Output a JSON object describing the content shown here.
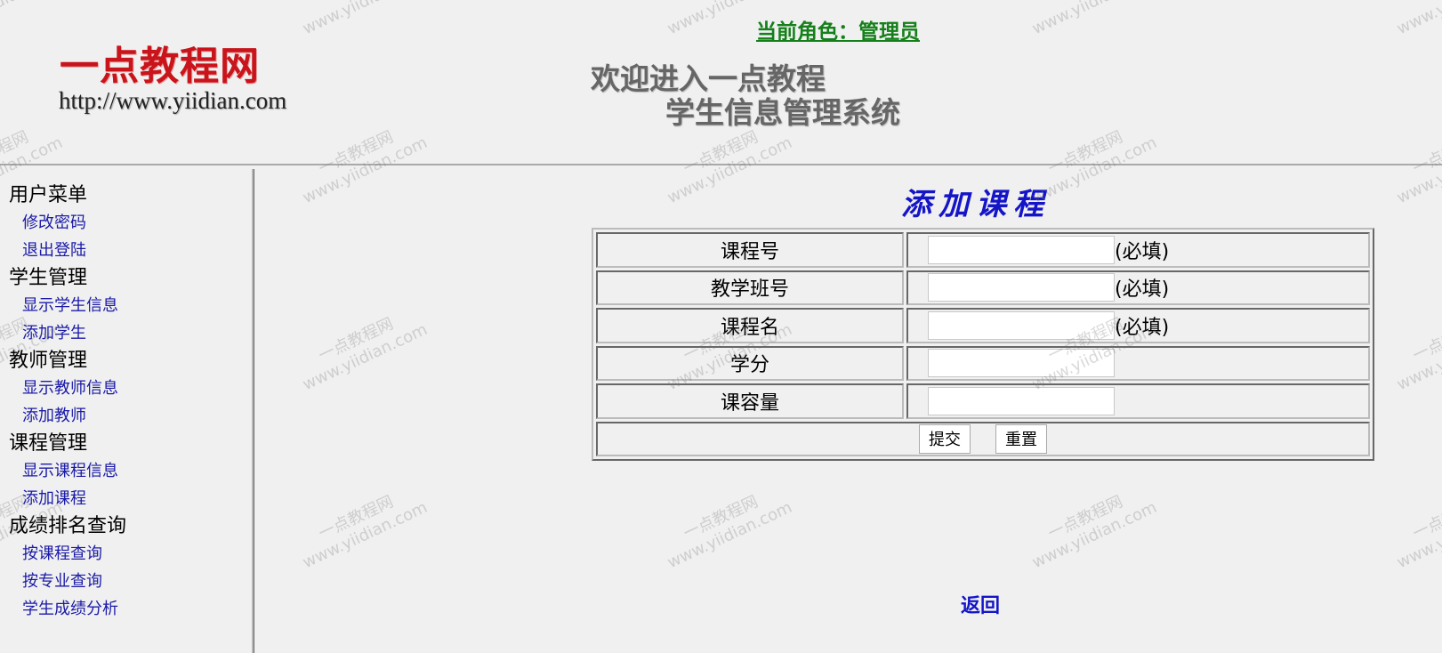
{
  "header": {
    "logo_title": "一点教程网",
    "logo_url": "http://www.yiidian.com",
    "role_text": "当前角色：管理员",
    "welcome_line1": "欢迎进入一点教程",
    "welcome_line2": "学生信息管理系统"
  },
  "sidebar": {
    "groups": [
      {
        "title": "用户菜单",
        "items": [
          "修改密码",
          "退出登陆"
        ]
      },
      {
        "title": "学生管理",
        "items": [
          "显示学生信息",
          "添加学生"
        ]
      },
      {
        "title": "教师管理",
        "items": [
          "显示教师信息",
          "添加教师"
        ]
      },
      {
        "title": "课程管理",
        "items": [
          "显示课程信息",
          "添加课程"
        ]
      },
      {
        "title": "成绩排名查询",
        "items": [
          "按课程查询",
          "按专业查询",
          "学生成绩分析"
        ]
      }
    ]
  },
  "form": {
    "title": "添加课程",
    "fields": [
      {
        "label": "课程号",
        "value": "",
        "required_note": "(必填)"
      },
      {
        "label": "教学班号",
        "value": "",
        "required_note": "(必填)"
      },
      {
        "label": "课程名",
        "value": "",
        "required_note": "(必填)"
      },
      {
        "label": "学分",
        "value": "",
        "required_note": ""
      },
      {
        "label": "课容量",
        "value": "",
        "required_note": ""
      }
    ],
    "submit_label": "提交",
    "reset_label": "重置"
  },
  "back_link": "返回",
  "watermark": {
    "line1": "一点教程网",
    "line2": "www.yiidian.com"
  }
}
